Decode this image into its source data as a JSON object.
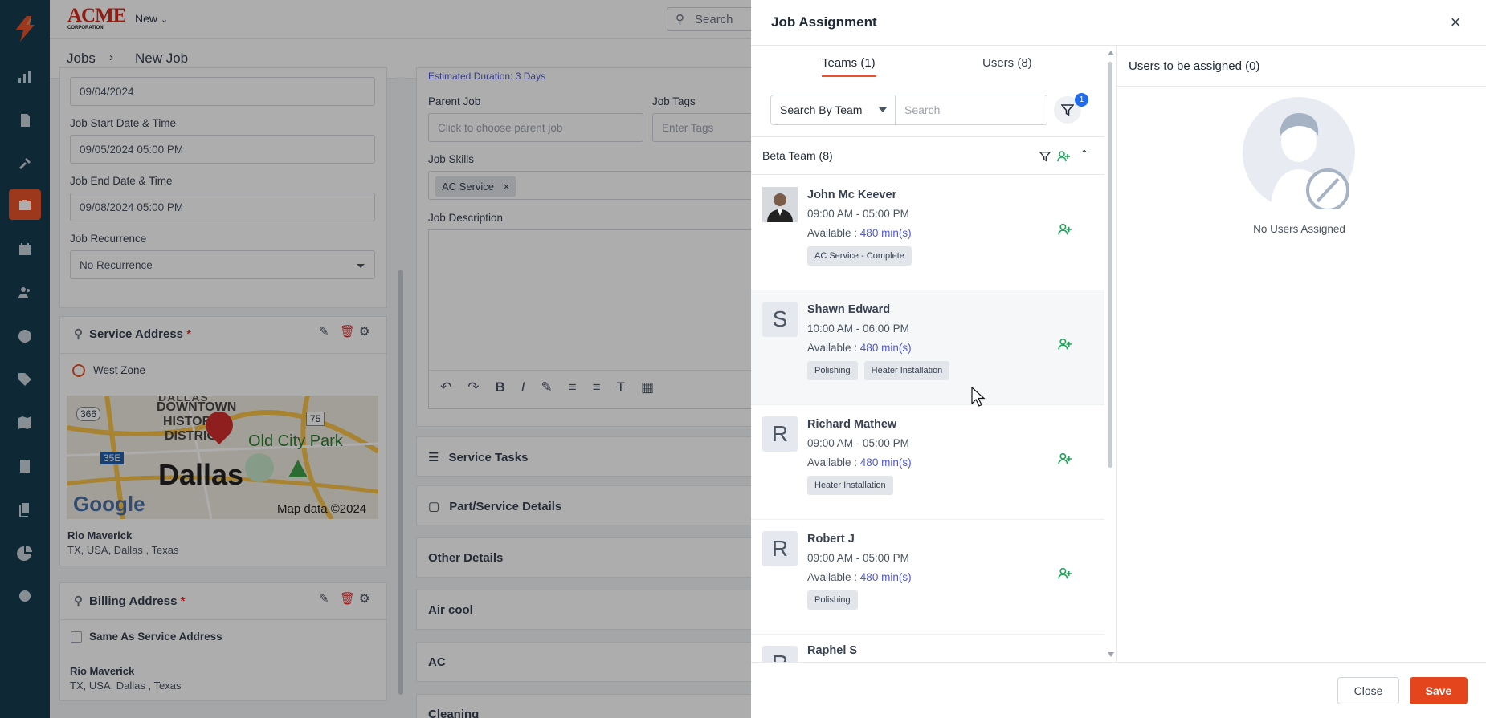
{
  "brand": {
    "logo_text": "ACME",
    "logo_sub": "CORPORATION",
    "accent": "#e8532b"
  },
  "topbar": {
    "new_label": "New",
    "search_placeholder": "Search"
  },
  "breadcrumb": {
    "root": "Jobs",
    "current": "New Job"
  },
  "job_form": {
    "top_date": "09/04/2024",
    "start_label": "Job Start Date & Time",
    "start_value": "09/05/2024 05:00 PM",
    "end_label": "Job End Date & Time",
    "end_value": "09/08/2024 05:00 PM",
    "recurrence_label": "Job Recurrence",
    "recurrence_value": "No Recurrence",
    "service_address_title": "Service Address",
    "zone": "West Zone",
    "service_name": "Rio Maverick",
    "service_addr": "TX, USA, Dallas , Texas",
    "billing_title": "Billing Address",
    "same_as_label": "Same As Service Address",
    "billing_name": "Rio Maverick",
    "billing_addr": "TX, USA, Dallas , Texas",
    "map": {
      "city": "Dallas",
      "district1": "DOWNTOWN",
      "district2": "HISTORIC",
      "district3": "DISTRICT",
      "park": "Old City Park",
      "google": "Google",
      "credit": "Map data ©2024",
      "hw1": "366",
      "hw2": "35E",
      "hw3": "75",
      "top": "DALLAS"
    }
  },
  "middle": {
    "estimated": "Estimated Duration: 3 Days",
    "parent_label": "Parent Job",
    "parent_placeholder": "Click to choose parent job",
    "tags_label": "Job Tags",
    "tags_placeholder": "Enter Tags",
    "skills_label": "Job Skills",
    "skill_chip": "AC Service",
    "desc_label": "Job Description",
    "sections": [
      "Service Tasks",
      "Part/Service Details",
      "Other Details",
      "Air cool",
      "AC",
      "Cleaning"
    ]
  },
  "drawer": {
    "title": "Job Assignment",
    "tabs": {
      "teams": "Teams (1)",
      "users": "Users (8)"
    },
    "search_by": "Search By Team",
    "search_placeholder": "Search",
    "filter_badge": "1",
    "team_name": "Beta Team (8)",
    "available_prefix": "Available : ",
    "users": [
      {
        "name": "John Mc Keever",
        "initial": "",
        "time": "09:00 AM - 05:00 PM",
        "mins": "480 min(s)",
        "skills": [
          "AC Service - Complete"
        ]
      },
      {
        "name": "Shawn Edward",
        "initial": "S",
        "time": "10:00 AM - 06:00 PM",
        "mins": "480 min(s)",
        "skills": [
          "Polishing",
          "Heater Installation"
        ]
      },
      {
        "name": "Richard Mathew",
        "initial": "R",
        "time": "09:00 AM - 05:00 PM",
        "mins": "480 min(s)",
        "skills": [
          "Heater Installation"
        ]
      },
      {
        "name": "Robert J",
        "initial": "R",
        "time": "09:00 AM - 05:00 PM",
        "mins": "480 min(s)",
        "skills": [
          "Polishing"
        ]
      },
      {
        "name": "Raphel S",
        "initial": "R",
        "time": "",
        "mins": "",
        "skills": []
      }
    ],
    "assigned_title": "Users to be assigned (0)",
    "empty_text": "No Users Assigned",
    "close_label": "Close",
    "save_label": "Save"
  }
}
